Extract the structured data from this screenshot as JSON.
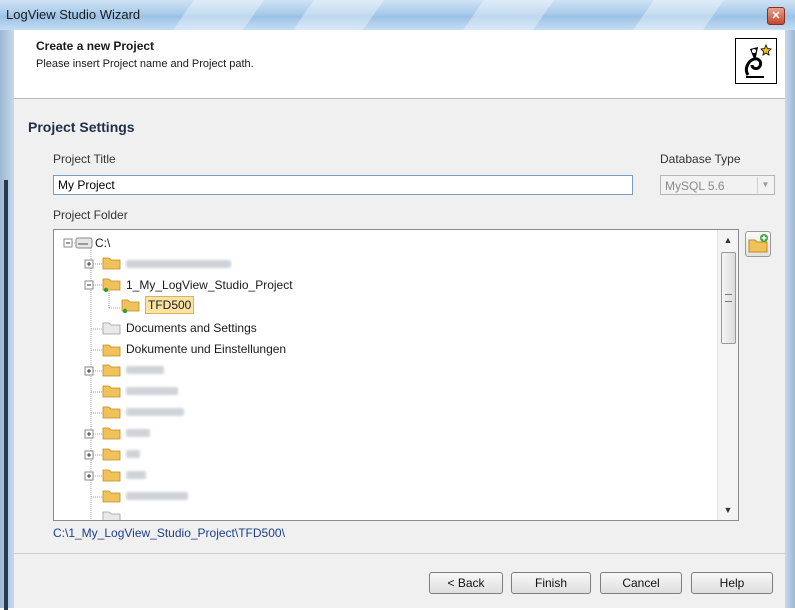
{
  "window": {
    "title": "LogView Studio Wizard",
    "close_glyph": "✕"
  },
  "header": {
    "title": "Create a new Project",
    "subtitle": "Please insert Project name and Project path."
  },
  "section": {
    "title": "Project Settings"
  },
  "project_title": {
    "label": "Project Title",
    "value": "My Project"
  },
  "database_type": {
    "label": "Database Type",
    "value": "MySQL 5.6"
  },
  "project_folder": {
    "label": "Project Folder",
    "root": "C:\\",
    "items": [
      {
        "label": "1_My_LogView_Studio_Project"
      },
      {
        "label": "TFD500"
      },
      {
        "label": "Documents and Settings"
      },
      {
        "label": "Dokumente und Einstellungen"
      }
    ]
  },
  "selected_path": "C:\\1_My_LogView_Studio_Project\\TFD500\\",
  "buttons": {
    "back": "< Back",
    "finish": "Finish",
    "cancel": "Cancel",
    "help": "Help"
  },
  "icons": {
    "new_folder": "folder-new-icon",
    "logo": "wizard-logo-icon"
  },
  "colors": {
    "selection": "#fbe3a4",
    "path_text": "#1e3f8a",
    "title_bar": "#a9cbe9"
  }
}
